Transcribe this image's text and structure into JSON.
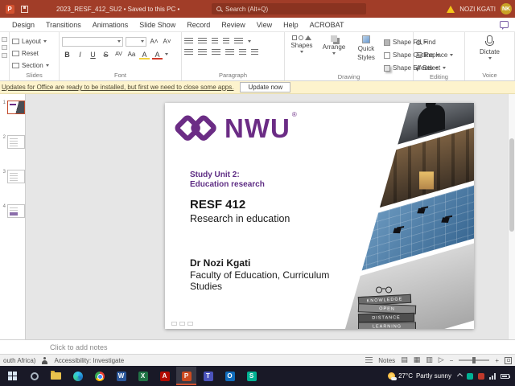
{
  "titlebar": {
    "title": "2023_RESF_412_SU2 • Saved to this PC •",
    "search_placeholder": "Search (Alt+Q)",
    "user_name": "NOZI KGATI",
    "user_initials": "NK"
  },
  "ribbon": {
    "tabs": [
      "Design",
      "Transitions",
      "Animations",
      "Slide Show",
      "Record",
      "Review",
      "View",
      "Help",
      "ACROBAT"
    ],
    "groups": {
      "slides": {
        "label": "Slides",
        "layout": "Layout",
        "reset": "Reset",
        "section": "Section"
      },
      "font": {
        "label": "Font",
        "bold": "B",
        "italic": "I",
        "underline": "U",
        "strike": "S",
        "spacing": "AV",
        "case_btn": "Aa"
      },
      "paragraph": {
        "label": "Paragraph"
      },
      "drawing": {
        "label": "Drawing",
        "shapes": "Shapes",
        "arrange": "Arrange",
        "quick1": "Quick",
        "quick2": "Styles",
        "shape_fill": "Shape Fill",
        "shape_outline": "Shape Outline",
        "shape_effects": "Shape Effects"
      },
      "editing": {
        "label": "Editing",
        "find": "Find",
        "replace": "Replace",
        "select": "Select"
      },
      "voice": {
        "label": "Voice",
        "dictate": "Dictate"
      }
    }
  },
  "notification": {
    "message": "Updates for Office are ready to be installed, but first we need to close some apps.",
    "action": "Update now"
  },
  "thumbnails": [
    {
      "number": "1"
    },
    {
      "number": "2"
    },
    {
      "number": "3"
    },
    {
      "number": "4"
    }
  ],
  "slide": {
    "logo_text": "NWU",
    "registered": "®",
    "subtitle_line1": "Study Unit 2:",
    "subtitle_line2": "Education research",
    "course_code": "RESF 412",
    "course_name": "Research in education",
    "author": "Dr Nozi Kgati",
    "affiliation": "Faculty of Education, Curriculum Studies",
    "book_labels": [
      "KNOWLEDGE",
      "OPEN",
      "DISTANCE",
      "LEARNING"
    ]
  },
  "notes": {
    "placeholder": "Click to add notes"
  },
  "statusbar": {
    "language": "outh Africa)",
    "accessibility": "Accessibility: Investigate",
    "notes_label": "Notes"
  },
  "taskbar": {
    "weather_temp": "27°C",
    "weather_condition": "Partly sunny",
    "icons": [
      "start",
      "settings",
      "file-explorer",
      "edge",
      "chrome",
      "word",
      "excel",
      "acrobat",
      "powerpoint",
      "teams",
      "outlook",
      "store"
    ],
    "active_icon": "powerpoint",
    "app_letters": {
      "word": "W",
      "excel": "X",
      "acrobat": "A",
      "powerpoint": "P",
      "teams": "T",
      "outlook": "O",
      "store": "S"
    }
  },
  "icons": {
    "search": "magnifier",
    "warning": "yellow-triangle",
    "comments": "speech-bubble",
    "dictate": "microphone",
    "accessibility": "person"
  },
  "colors": {
    "titlebar": "#a13d28",
    "nwu_purple": "#6b2c85",
    "notification_bg": "#fdf3cd",
    "taskbar_bg": "#191927",
    "powerpoint_orange": "#cb4a1f",
    "selection_red": "#c24a2b"
  }
}
